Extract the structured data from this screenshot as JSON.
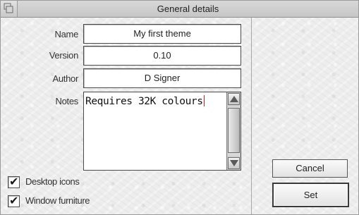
{
  "window": {
    "title": "General details"
  },
  "form": {
    "name": {
      "label": "Name",
      "value": "My first theme"
    },
    "version": {
      "label": "Version",
      "value": "0.10"
    },
    "author": {
      "label": "Author",
      "value": "D Signer"
    },
    "notes": {
      "label": "Notes",
      "value": "Requires 32K colours"
    }
  },
  "options": [
    {
      "label": "Desktop icons",
      "checked": true
    },
    {
      "label": "Window furniture",
      "checked": true
    }
  ],
  "buttons": {
    "cancel_label": "Cancel",
    "set_label": "Set"
  },
  "icons": {
    "title_back": "window-back-icon",
    "scroll_up": "up-arrow-icon",
    "scroll_down": "down-arrow-icon",
    "checkmark": "checkmark-icon"
  }
}
